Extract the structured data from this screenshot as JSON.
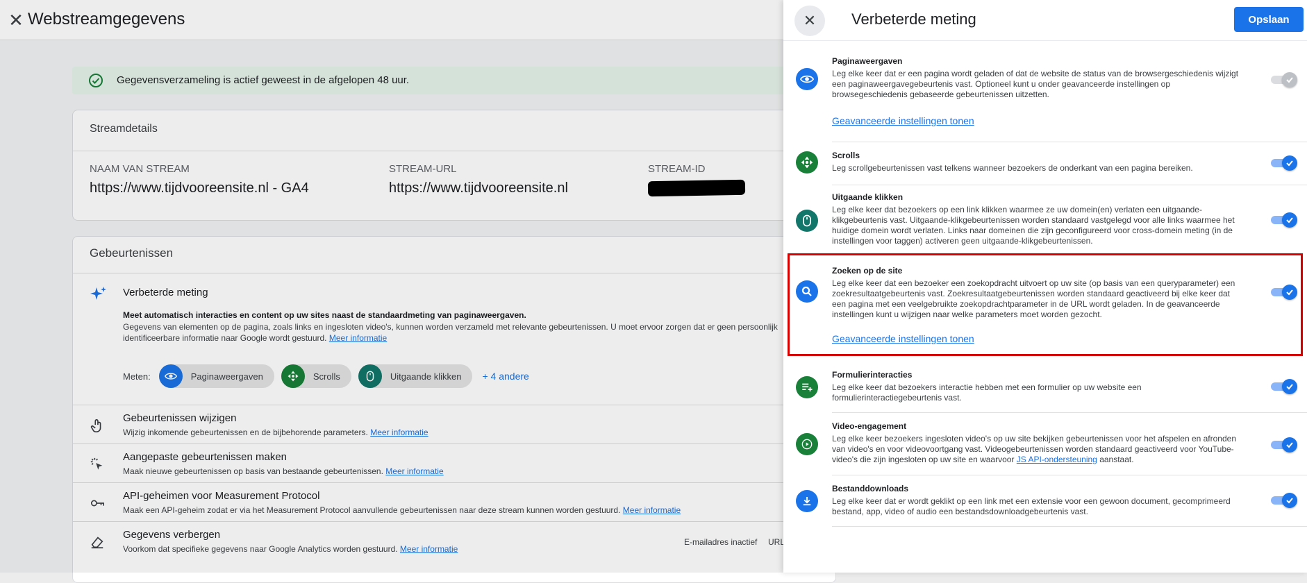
{
  "background": {
    "title": "Webstreamgegevens",
    "status_text": "Gegevensverzameling is actief geweest in de afgelopen 48 uur.",
    "stream_details": {
      "title": "Streamdetails",
      "columns": [
        {
          "label": "NAAM VAN STREAM",
          "value": "https://www.tijdvooreensite.nl - GA4"
        },
        {
          "label": "STREAM-URL",
          "value": "https://www.tijdvooreensite.nl"
        },
        {
          "label": "STREAM-ID",
          "value": ""
        }
      ]
    },
    "events": {
      "title": "Gebeurtenissen",
      "enhanced": {
        "title": "Verbeterde meting",
        "bold_line": "Meet automatisch interacties en content op uw sites naast de standaardmeting van paginaweergaven.",
        "desc": "Gegevens van elementen op de pagina, zoals links en ingesloten video's, kunnen worden verzameld met relevante gebeurtenissen. U moet ervoor zorgen dat er geen persoonlijk identificeerbare informatie naar Google wordt gestuurd.",
        "desc_link": "Meer informatie",
        "meten_label": "Meten:",
        "chips": [
          "Paginaweergaven",
          "Scrolls",
          "Uitgaande klikken"
        ],
        "more": "+ 4 andere"
      },
      "rows": [
        {
          "title": "Gebeurtenissen wijzigen",
          "desc": "Wijzig inkomende gebeurtenissen en de bijbehorende parameters.",
          "link": "Meer informatie",
          "status": ""
        },
        {
          "title": "Aangepaste gebeurtenissen maken",
          "desc": "Maak nieuwe gebeurtenissen op basis van bestaande gebeurtenissen.",
          "link": "Meer informatie",
          "status": ""
        },
        {
          "title": "API-geheimen voor Measurement Protocol",
          "desc": "Maak een API-geheim zodat er via het Measurement Protocol aanvullende gebeurtenissen naar deze stream kunnen worden gestuurd.",
          "link": "Meer informatie",
          "status": ""
        },
        {
          "title": "Gegevens verbergen",
          "desc": "Voorkom dat specifieke gegevens naar Google Analytics worden gestuurd.",
          "link": "Meer informatie",
          "status": "E-mailadres inactief",
          "status2": "URL"
        }
      ]
    }
  },
  "panel": {
    "title": "Verbeterde meting",
    "save_label": "Opslaan",
    "settings": [
      {
        "title": "Paginaweergaven",
        "desc": "Leg elke keer dat er een pagina wordt geladen of dat de website de status van de browsergeschiedenis wijzigt een paginaweergavegebeurtenis vast. Optioneel kunt u onder geavanceerde instellingen op browsegeschiedenis gebaseerde gebeurtenissen uitzetten.",
        "link": "Geavanceerde instellingen tonen",
        "enabled": true,
        "locked": true
      },
      {
        "title": "Scrolls",
        "desc": "Leg scrollgebeurtenissen vast telkens wanneer bezoekers de onderkant van een pagina bereiken.",
        "enabled": true
      },
      {
        "title": "Uitgaande klikken",
        "desc": "Leg elke keer dat bezoekers op een link klikken waarmee ze uw domein(en) verlaten een uitgaande-klikgebeurtenis vast. Uitgaande-klikgebeurtenissen worden standaard vastgelegd voor alle links waarmee het huidige domein wordt verlaten. Links naar domeinen die zijn geconfigureerd voor cross-domein meting (in de instellingen voor taggen) activeren geen uitgaande-klikgebeurtenissen.",
        "enabled": true
      },
      {
        "title": "Zoeken op de site",
        "desc": "Leg elke keer dat een bezoeker een zoekopdracht uitvoert op uw site (op basis van een queryparameter) een zoekresultaatgebeurtenis vast. Zoekresultaatgebeurtenissen worden standaard geactiveerd bij elke keer dat een pagina met een veelgebruikte zoekopdrachtparameter in de URL wordt geladen. In de geavanceerde instellingen kunt u wijzigen naar welke parameters moet worden gezocht.",
        "link": "Geavanceerde instellingen tonen",
        "enabled": true
      },
      {
        "title": "Formulierinteracties",
        "desc": "Leg elke keer dat bezoekers interactie hebben met een formulier op uw website een formulierinteractiegebeurtenis vast.",
        "enabled": true
      },
      {
        "title": "Video-engagement",
        "desc_before": "Leg elke keer bezoekers ingesloten video's op uw site bekijken gebeurtenissen voor het afspelen en afronden van video's en voor videovoortgang vast. Videogebeurtenissen worden standaard geactiveerd voor YouTube-video's die zijn ingesloten op uw site en waarvoor ",
        "desc_link": "JS API-ondersteuning",
        "desc_after": " aanstaat.",
        "enabled": true
      },
      {
        "title": "Bestanddownloads",
        "desc": "Leg elke keer dat er wordt geklikt op een link met een extensie voor een gewoon document, gecomprimeerd bestand, app, video of audio een bestandsdownloadgebeurtenis vast.",
        "enabled": true
      }
    ]
  },
  "colors": {
    "accent": "#1a73e8",
    "green": "#188038",
    "teal": "#12766a",
    "highlight": "#d50000"
  },
  "icons": [
    "close-icon",
    "check-circle-icon",
    "sparkle-icon",
    "eye-icon",
    "scroll-icon",
    "mouse-icon",
    "search-icon",
    "form-icon",
    "play-icon",
    "download-icon",
    "touch-icon",
    "cursor-click-icon",
    "key-icon",
    "eraser-icon",
    "check-icon"
  ]
}
